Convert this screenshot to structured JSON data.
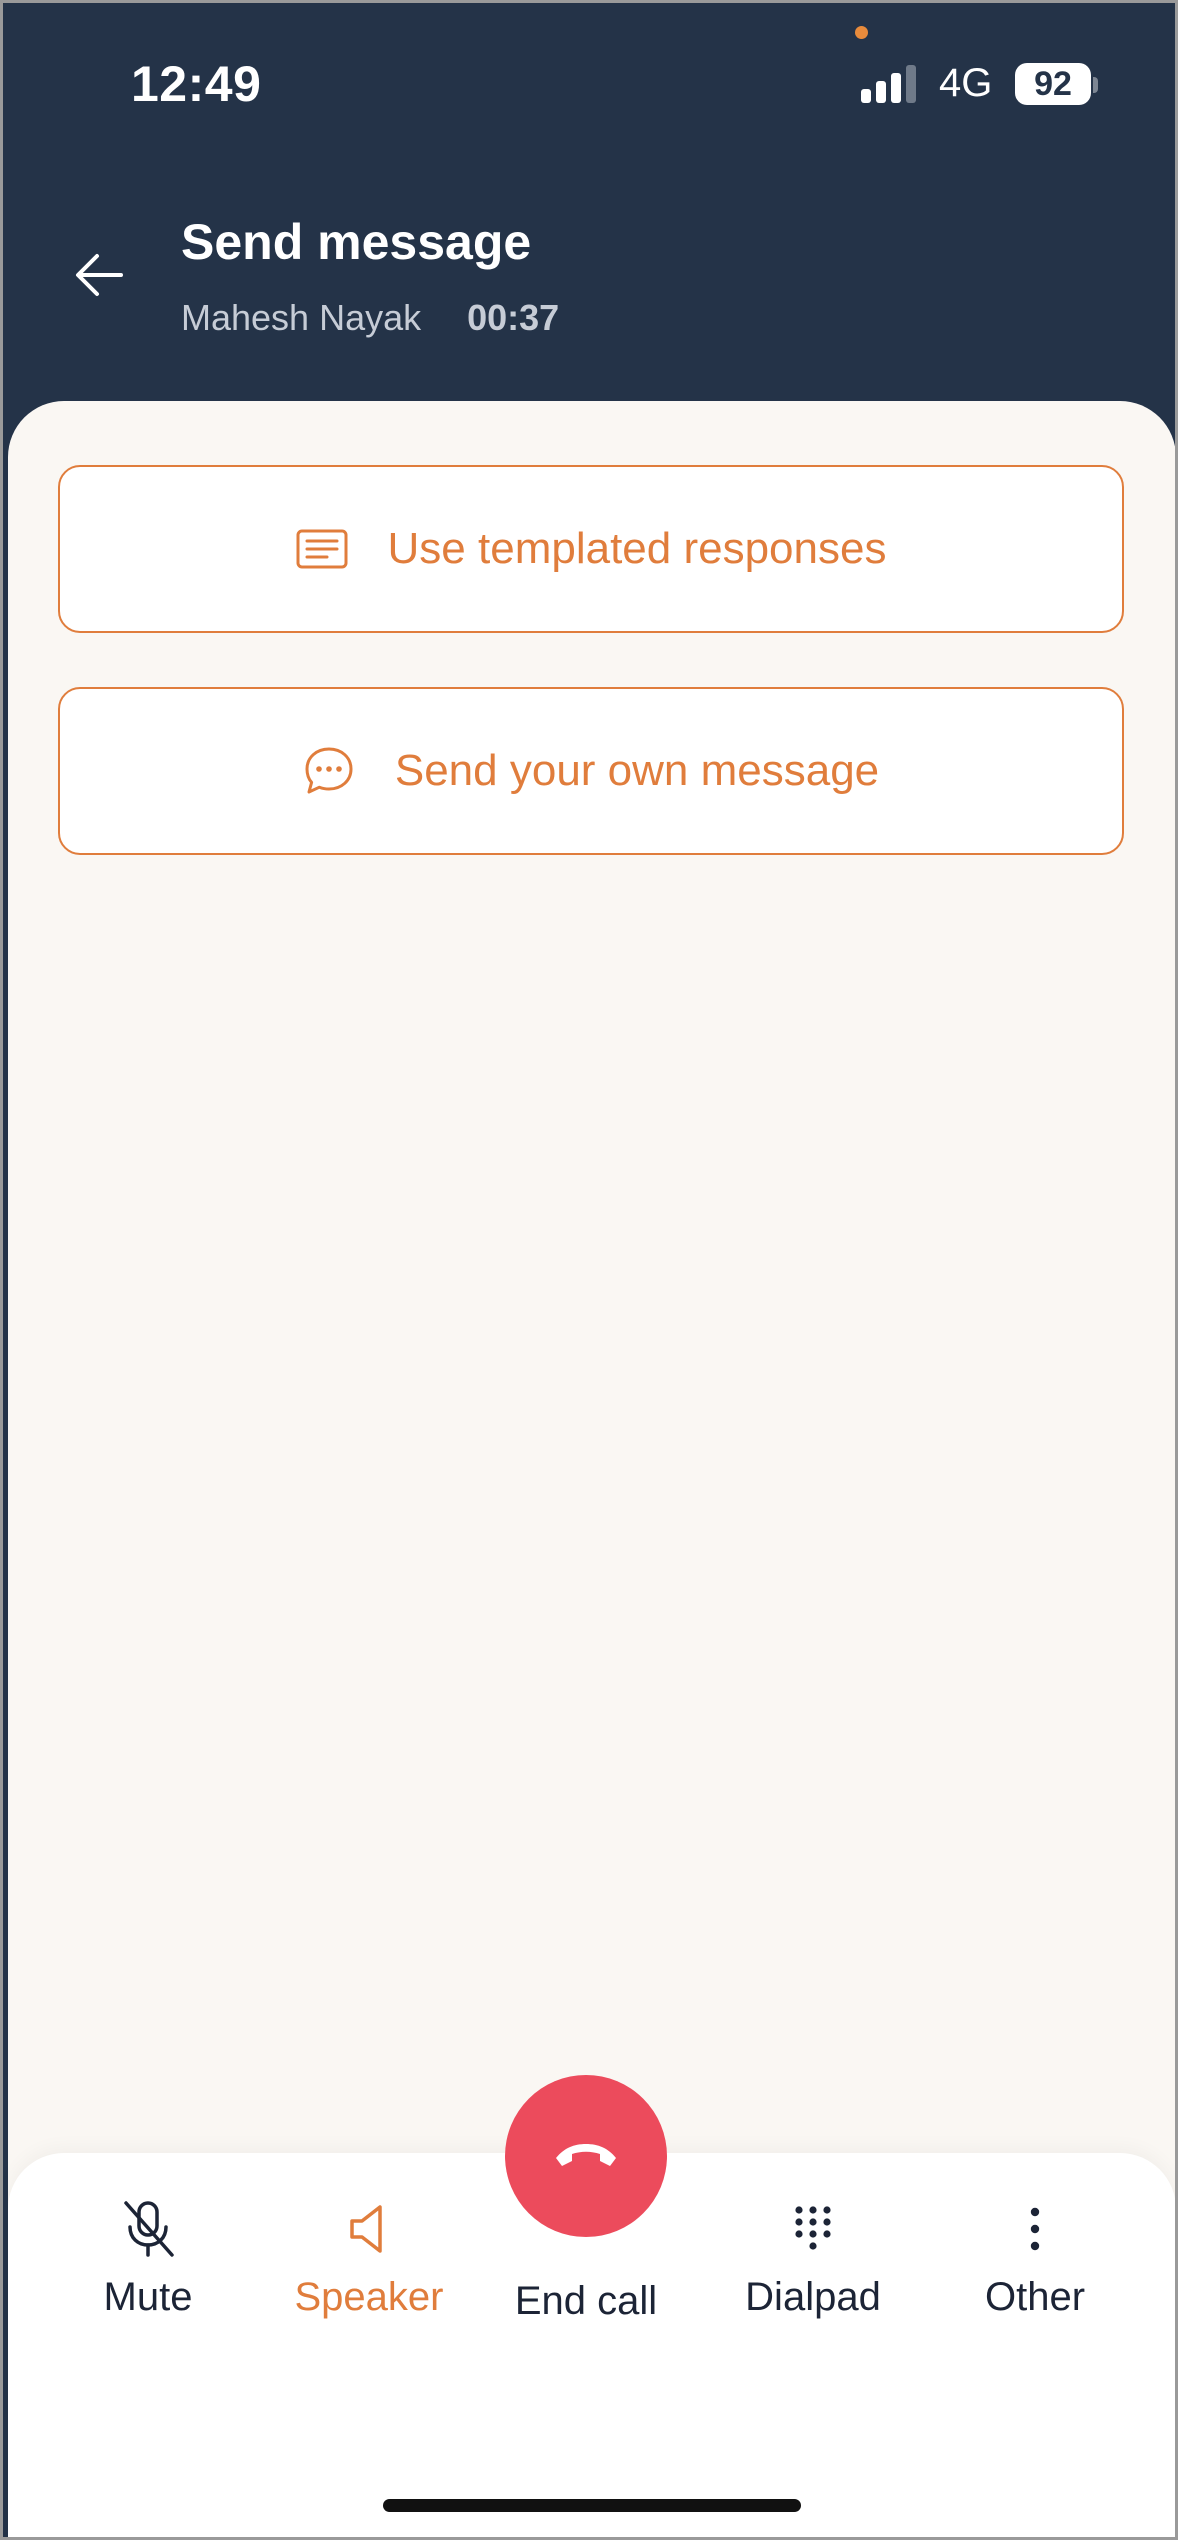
{
  "status_bar": {
    "time": "12:49",
    "network": "4G",
    "battery": "92"
  },
  "header": {
    "title": "Send message",
    "contact_name": "Mahesh Nayak",
    "call_timer": "00:37"
  },
  "options": [
    {
      "label": "Use templated responses",
      "icon": "document-lines-icon"
    },
    {
      "label": "Send your own message",
      "icon": "chat-bubble-icon"
    }
  ],
  "controls": {
    "mute": "Mute",
    "speaker": "Speaker",
    "end_call": "End call",
    "dialpad": "Dialpad",
    "other": "Other"
  },
  "colors": {
    "header_bg": "#243348",
    "accent": "#e07d3c",
    "end_call": "#ec4b5c",
    "content_bg": "#faf7f3"
  }
}
